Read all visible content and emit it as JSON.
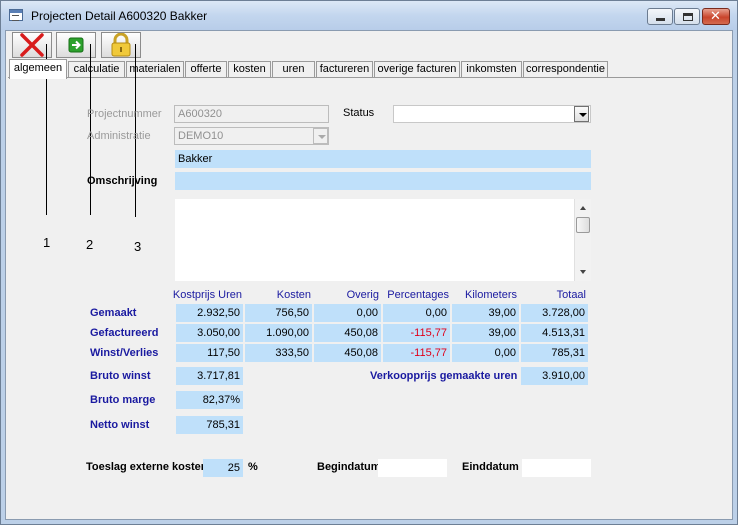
{
  "window": {
    "title": "Projecten Detail   A600320   Bakker"
  },
  "toolbar": {
    "cancel_icon": "close-x-icon",
    "next_icon": "arrow-right-icon",
    "lock_icon": "lock-icon"
  },
  "callouts": [
    "1",
    "2",
    "3"
  ],
  "tabs": [
    "algemeen",
    "calculatie",
    "materialen",
    "offerte",
    "kosten",
    "uren",
    "factureren",
    "overige facturen",
    "inkomsten",
    "correspondentie"
  ],
  "form": {
    "projectnummer_label": "Projectnummer",
    "projectnummer_value": "A600320",
    "administratie_label": "Administratie",
    "administratie_value": "DEMO10",
    "status_label": "Status",
    "status_value": "",
    "name_value": "Bakker",
    "omschrijving_label": "Omschrijving",
    "omschrijving_value": "",
    "memo_value": ""
  },
  "summary": {
    "headers": [
      "Kostprijs Uren",
      "Kosten",
      "Overig",
      "Percentages",
      "Kilometers",
      "Totaal"
    ],
    "rows": [
      {
        "label": "Gemaakt",
        "values": [
          "2.932,50",
          "756,50",
          "0,00",
          "0,00",
          "39,00",
          "3.728,00"
        ]
      },
      {
        "label": "Gefactureerd",
        "values": [
          "3.050,00",
          "1.090,00",
          "450,08",
          "-115,77",
          "39,00",
          "4.513,31"
        ]
      },
      {
        "label": "Winst/Verlies",
        "values": [
          "117,50",
          "333,50",
          "450,08",
          "-115,77",
          "0,00",
          "785,31"
        ]
      }
    ],
    "bruto_winst_label": "Bruto winst",
    "bruto_winst_value": "3.717,81",
    "bruto_marge_label": "Bruto marge",
    "bruto_marge_value": "82,37%",
    "netto_winst_label": "Netto winst",
    "netto_winst_value": "785,31",
    "verkoopprijs_label": "Verkoopprijs gemaakte uren",
    "verkoopprijs_value": "3.910,00"
  },
  "footer": {
    "toeslag_label": "Toeslag externe kosten",
    "toeslag_value": "25",
    "toeslag_unit": "%",
    "begindatum_label": "Begindatum",
    "begindatum_value": "",
    "einddatum_label": "Einddatum",
    "einddatum_value": ""
  },
  "colors": {
    "field_blue": "#bfe0fa",
    "label_blue": "#1a1aa0",
    "negative_red": "#e0001a"
  }
}
